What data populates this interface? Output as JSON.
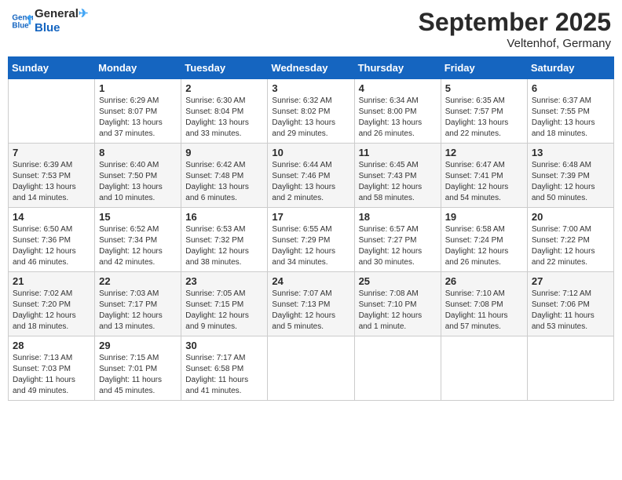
{
  "header": {
    "logo_line1": "General",
    "logo_line2": "Blue",
    "month": "September 2025",
    "location": "Veltenhof, Germany"
  },
  "days_of_week": [
    "Sunday",
    "Monday",
    "Tuesday",
    "Wednesday",
    "Thursday",
    "Friday",
    "Saturday"
  ],
  "weeks": [
    [
      {
        "day": "",
        "info": ""
      },
      {
        "day": "1",
        "info": "Sunrise: 6:29 AM\nSunset: 8:07 PM\nDaylight: 13 hours\nand 37 minutes."
      },
      {
        "day": "2",
        "info": "Sunrise: 6:30 AM\nSunset: 8:04 PM\nDaylight: 13 hours\nand 33 minutes."
      },
      {
        "day": "3",
        "info": "Sunrise: 6:32 AM\nSunset: 8:02 PM\nDaylight: 13 hours\nand 29 minutes."
      },
      {
        "day": "4",
        "info": "Sunrise: 6:34 AM\nSunset: 8:00 PM\nDaylight: 13 hours\nand 26 minutes."
      },
      {
        "day": "5",
        "info": "Sunrise: 6:35 AM\nSunset: 7:57 PM\nDaylight: 13 hours\nand 22 minutes."
      },
      {
        "day": "6",
        "info": "Sunrise: 6:37 AM\nSunset: 7:55 PM\nDaylight: 13 hours\nand 18 minutes."
      }
    ],
    [
      {
        "day": "7",
        "info": "Sunrise: 6:39 AM\nSunset: 7:53 PM\nDaylight: 13 hours\nand 14 minutes."
      },
      {
        "day": "8",
        "info": "Sunrise: 6:40 AM\nSunset: 7:50 PM\nDaylight: 13 hours\nand 10 minutes."
      },
      {
        "day": "9",
        "info": "Sunrise: 6:42 AM\nSunset: 7:48 PM\nDaylight: 13 hours\nand 6 minutes."
      },
      {
        "day": "10",
        "info": "Sunrise: 6:44 AM\nSunset: 7:46 PM\nDaylight: 13 hours\nand 2 minutes."
      },
      {
        "day": "11",
        "info": "Sunrise: 6:45 AM\nSunset: 7:43 PM\nDaylight: 12 hours\nand 58 minutes."
      },
      {
        "day": "12",
        "info": "Sunrise: 6:47 AM\nSunset: 7:41 PM\nDaylight: 12 hours\nand 54 minutes."
      },
      {
        "day": "13",
        "info": "Sunrise: 6:48 AM\nSunset: 7:39 PM\nDaylight: 12 hours\nand 50 minutes."
      }
    ],
    [
      {
        "day": "14",
        "info": "Sunrise: 6:50 AM\nSunset: 7:36 PM\nDaylight: 12 hours\nand 46 minutes."
      },
      {
        "day": "15",
        "info": "Sunrise: 6:52 AM\nSunset: 7:34 PM\nDaylight: 12 hours\nand 42 minutes."
      },
      {
        "day": "16",
        "info": "Sunrise: 6:53 AM\nSunset: 7:32 PM\nDaylight: 12 hours\nand 38 minutes."
      },
      {
        "day": "17",
        "info": "Sunrise: 6:55 AM\nSunset: 7:29 PM\nDaylight: 12 hours\nand 34 minutes."
      },
      {
        "day": "18",
        "info": "Sunrise: 6:57 AM\nSunset: 7:27 PM\nDaylight: 12 hours\nand 30 minutes."
      },
      {
        "day": "19",
        "info": "Sunrise: 6:58 AM\nSunset: 7:24 PM\nDaylight: 12 hours\nand 26 minutes."
      },
      {
        "day": "20",
        "info": "Sunrise: 7:00 AM\nSunset: 7:22 PM\nDaylight: 12 hours\nand 22 minutes."
      }
    ],
    [
      {
        "day": "21",
        "info": "Sunrise: 7:02 AM\nSunset: 7:20 PM\nDaylight: 12 hours\nand 18 minutes."
      },
      {
        "day": "22",
        "info": "Sunrise: 7:03 AM\nSunset: 7:17 PM\nDaylight: 12 hours\nand 13 minutes."
      },
      {
        "day": "23",
        "info": "Sunrise: 7:05 AM\nSunset: 7:15 PM\nDaylight: 12 hours\nand 9 minutes."
      },
      {
        "day": "24",
        "info": "Sunrise: 7:07 AM\nSunset: 7:13 PM\nDaylight: 12 hours\nand 5 minutes."
      },
      {
        "day": "25",
        "info": "Sunrise: 7:08 AM\nSunset: 7:10 PM\nDaylight: 12 hours\nand 1 minute."
      },
      {
        "day": "26",
        "info": "Sunrise: 7:10 AM\nSunset: 7:08 PM\nDaylight: 11 hours\nand 57 minutes."
      },
      {
        "day": "27",
        "info": "Sunrise: 7:12 AM\nSunset: 7:06 PM\nDaylight: 11 hours\nand 53 minutes."
      }
    ],
    [
      {
        "day": "28",
        "info": "Sunrise: 7:13 AM\nSunset: 7:03 PM\nDaylight: 11 hours\nand 49 minutes."
      },
      {
        "day": "29",
        "info": "Sunrise: 7:15 AM\nSunset: 7:01 PM\nDaylight: 11 hours\nand 45 minutes."
      },
      {
        "day": "30",
        "info": "Sunrise: 7:17 AM\nSunset: 6:58 PM\nDaylight: 11 hours\nand 41 minutes."
      },
      {
        "day": "",
        "info": ""
      },
      {
        "day": "",
        "info": ""
      },
      {
        "day": "",
        "info": ""
      },
      {
        "day": "",
        "info": ""
      }
    ]
  ]
}
